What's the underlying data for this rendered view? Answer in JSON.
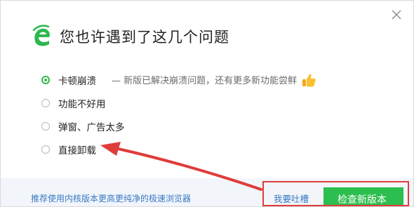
{
  "dialog": {
    "title": "您也许遇到了这几个问题",
    "close_icon": "close-icon",
    "logo_icon": "browser-e-logo-icon",
    "accent_color": "#2db84d"
  },
  "options": [
    {
      "label": "卡顿崩溃",
      "selected": true,
      "note": "— 新版已解决崩溃问题，还有更多新功能尝鲜"
    },
    {
      "label": "功能不好用",
      "selected": false
    },
    {
      "label": "弹窗、广告太多",
      "selected": false
    },
    {
      "label": "直接卸载",
      "selected": false
    }
  ],
  "thumb_icon": "thumbs-up-icon",
  "footer": {
    "recommend_link": "推荐使用内核版本更高更纯净的极速浏览器",
    "feedback_link": "我要吐槽",
    "check_button": "检查新版本",
    "button_color": "#2cbe4e"
  },
  "annotation": {
    "arrow_color": "#e03b3b",
    "box_color": "#e03b3b"
  }
}
